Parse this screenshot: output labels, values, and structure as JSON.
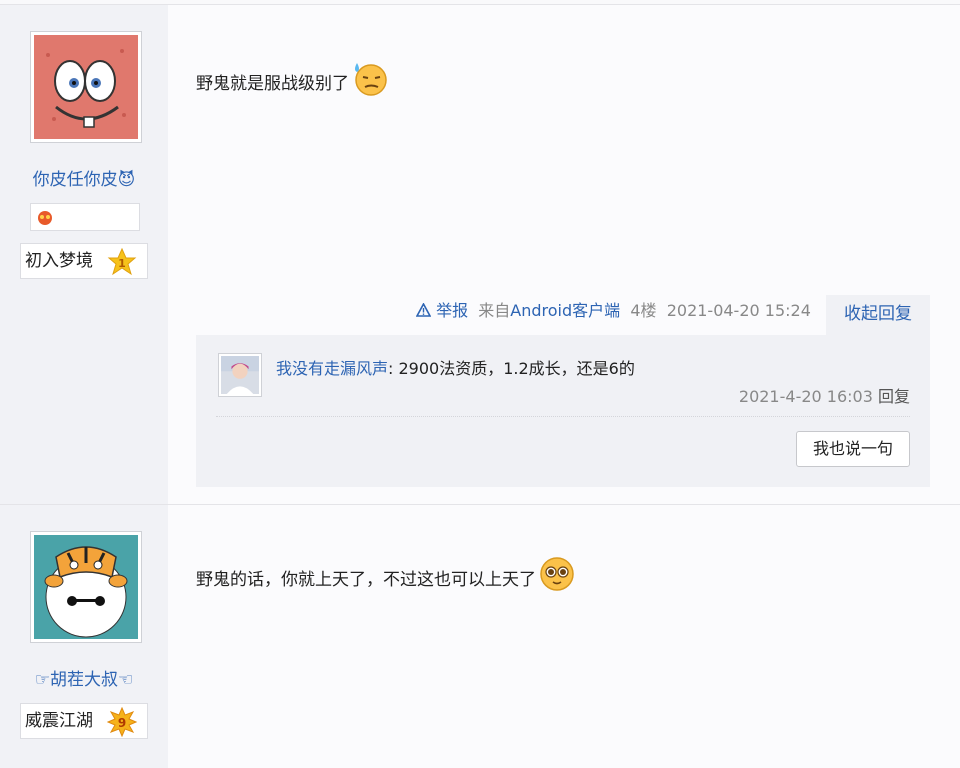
{
  "posts": [
    {
      "username": "你皮任你皮😈",
      "level_name": "初入梦境",
      "level_num": "1",
      "content": "野鬼就是服战级别了",
      "meta": {
        "report": "举报",
        "source_prefix": "来自",
        "source": "Android客户端",
        "floor": "4楼",
        "time": "2021-04-20 15:24"
      },
      "collapse_label": "收起回复",
      "replies": [
        {
          "name": "我没有走漏风声",
          "text": ": 2900法资质，1.2成长，还是6的",
          "time": "2021-4-20 16:03",
          "reply_label": "回复"
        }
      ],
      "say_button": "我也说一句"
    },
    {
      "username": "☞胡茬大叔☜",
      "level_name": "威震江湖",
      "level_num": "9",
      "content": "野鬼的话，你就上天了，不过这也可以上天了"
    }
  ],
  "colors": {
    "link": "#2d64b3",
    "side_bg": "#f1f2f6",
    "meta": "#888888",
    "star": "#f6c21a"
  },
  "icons": [
    "patrick-avatar",
    "tiger-baymax-avatar",
    "sweat-emoji",
    "hopeful-emoji",
    "warning-icon",
    "star-level-icon",
    "badge-icon"
  ]
}
